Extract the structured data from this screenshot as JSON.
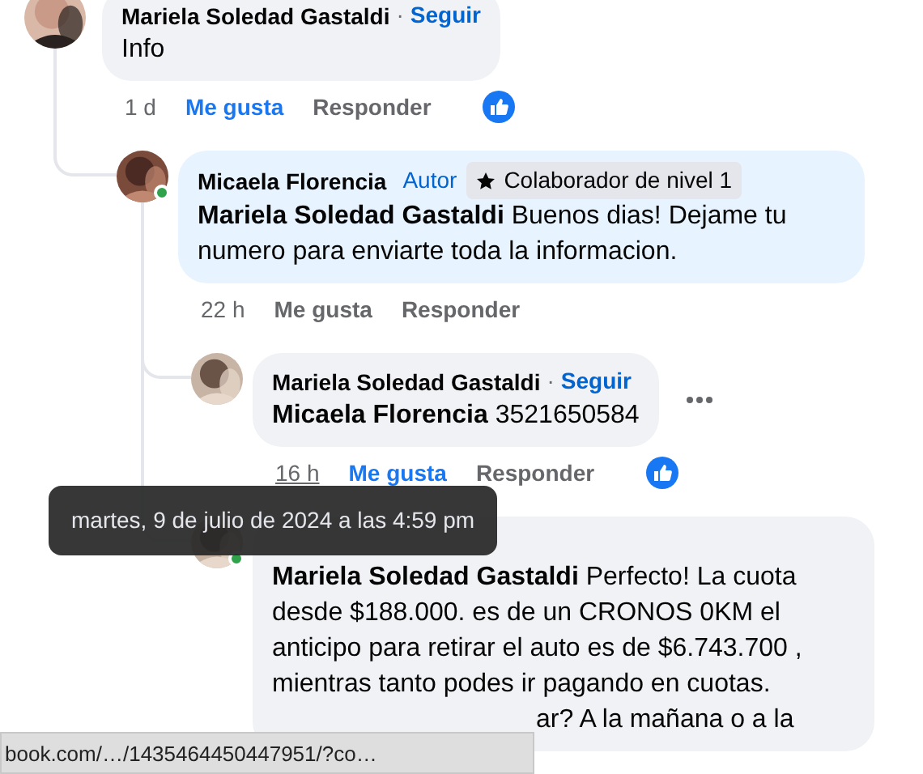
{
  "comments": [
    {
      "author": "Mariela Soledad Gastaldi",
      "follow_separator": "·",
      "follow": "Seguir",
      "text": "Info",
      "color": "#f0f2f5",
      "time": "1 d",
      "time_hovered": false,
      "like_label": "Me gusta",
      "liked": true,
      "reply_label": "Responder",
      "has_reaction": true,
      "children": [
        {
          "author": "Micaela Florencia",
          "author_tag": "Autor",
          "badge": "Colaborador de nivel 1",
          "mention": "Mariela Soledad Gastaldi",
          "text": "Buenos dias! Dejame tu numero para enviarte toda la informacion.",
          "color": "#e7f3ff",
          "online": true,
          "time": "22 h",
          "time_hovered": false,
          "like_label": "Me gusta",
          "liked": false,
          "reply_label": "Responder",
          "children": [
            {
              "author": "Mariela Soledad Gastaldi",
              "follow_separator": "·",
              "follow": "Seguir",
              "mention": "Micaela Florencia",
              "text": "3521650584",
              "color": "#f0f2f5",
              "time": "16 h",
              "time_hovered": true,
              "like_label": "Me gusta",
              "liked": true,
              "reply_label": "Responder",
              "has_reaction": true,
              "has_menu": true
            },
            {
              "mention": "Mariela Soledad Gastaldi",
              "text": "Perfecto! La cuota desde $188.000. es de un CRONOS 0KM el anticipo para retirar el auto es de $6.743.700 , mientras tanto podes ir pagando en cuotas.",
              "text_tail": "ar? A la mañana o a la",
              "color": "#f0f2f5",
              "online": true
            }
          ]
        }
      ]
    }
  ],
  "tooltip": "martes, 9 de julio de 2024 a las 4:59 pm",
  "status_bar": "book.com/…/1435464450447951/?co…"
}
